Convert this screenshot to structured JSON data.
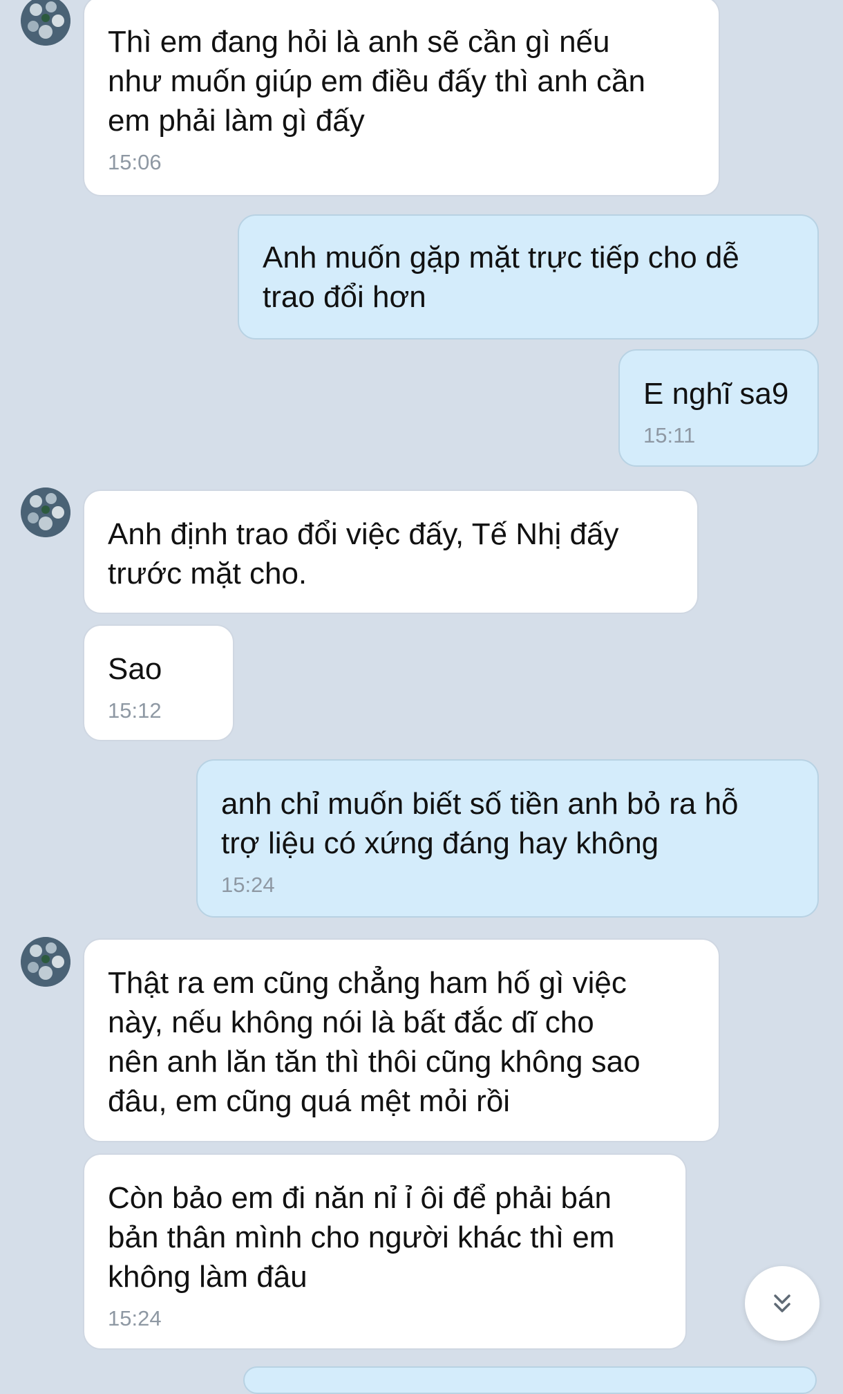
{
  "colors": {
    "background": "#d5dee9",
    "incoming_bubble": "#ffffff",
    "outgoing_bubble": "#d4ecfb",
    "timestamp": "#8e98a3"
  },
  "messages": [
    {
      "from": "contact",
      "text": "Thì em đang hỏi là anh sẽ cần gì nếu\nnhư muốn giúp em điều đấy thì anh cần\nem phải làm gì đấy",
      "time": "15:06"
    },
    {
      "from": "me",
      "text": "Anh muốn gặp mặt trực tiếp cho dễ\ntrao đổi hơn",
      "time": ""
    },
    {
      "from": "me",
      "text": "E nghĩ sa9",
      "time": "15:11"
    },
    {
      "from": "contact",
      "text": "Anh định trao đổi việc đấy, Tế Nhị đấy\ntrước mặt cho.",
      "time": ""
    },
    {
      "from": "contact",
      "text": "Sao",
      "time": "15:12"
    },
    {
      "from": "me",
      "text": "anh chỉ muốn biết số tiền anh bỏ ra hỗ\ntrợ liệu có xứng đáng hay không",
      "time": "15:24"
    },
    {
      "from": "contact",
      "text": "Thật ra em cũng chẳng ham hố gì việc\nnày, nếu không nói là bất đắc dĩ cho\nnên anh lăn tăn thì thôi cũng không sao\nđâu, em cũng quá mệt mỏi rồi",
      "time": ""
    },
    {
      "from": "contact",
      "text": "Còn bảo em đi năn nỉ ỉ ôi để phải bán\nbản thân mình cho người khác thì em\nkhông làm đâu",
      "time": "15:24"
    }
  ],
  "icons": {
    "avatar": "contact-avatar",
    "scroll_down": "double-chevron-down-icon"
  }
}
